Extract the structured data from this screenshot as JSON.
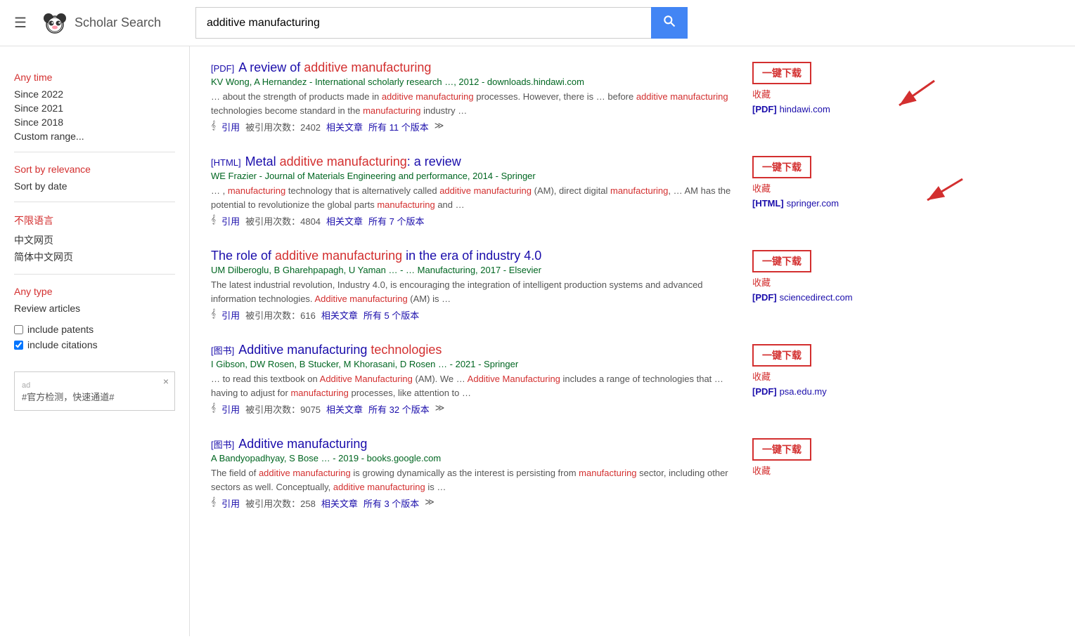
{
  "header": {
    "menu_icon": "☰",
    "logo_alt": "Scholar Search panda logo",
    "logo_text": "Scholar Search",
    "search_value": "additive manufacturing",
    "search_placeholder": "Search"
  },
  "sidebar": {
    "time_section_title": "Any time",
    "time_items": [
      {
        "label": "Since 2022",
        "active": false
      },
      {
        "label": "Since 2021",
        "active": false
      },
      {
        "label": "Since 2018",
        "active": false
      },
      {
        "label": "Custom range...",
        "active": false
      }
    ],
    "sort_section_title": "Sort by relevance",
    "sort_items": [
      {
        "label": "Sort by date",
        "active": false
      }
    ],
    "lang_section_title": "不限语言",
    "lang_items": [
      {
        "label": "中文网页"
      },
      {
        "label": "简体中文网页"
      }
    ],
    "type_section_title": "Any type",
    "type_items": [
      {
        "label": "Review articles"
      }
    ],
    "include_patents_label": "include patents",
    "include_citations_label": "include citations",
    "ad_text": "#官方检测，快速通道#",
    "ad_label": "ad",
    "ad_close": "×"
  },
  "results": [
    {
      "type_tag": "[PDF]",
      "title_parts": [
        "A review of ",
        "additive manufacturing"
      ],
      "title_plain": "A review of additive manufacturing",
      "authors_text": "KV Wong, A Hernandez",
      "journal_text": "International scholarly research …, 2012 - downloads.hindawi.com",
      "snippet": "… about the strength of products made in additive manufacturing processes. However, there is … before additive manufacturing technologies become standard in the manufacturing industry …",
      "meta_cite": "引用",
      "meta_cited": "被引用次数：2402",
      "meta_related": "相关文章",
      "meta_versions": "所有 11 个版本",
      "meta_more": "≫",
      "actions": {
        "download": "一键下载",
        "collect": "收藏",
        "pdf_tag": "[PDF]",
        "pdf_site": "hindawi.com"
      }
    },
    {
      "type_tag": "[HTML]",
      "title_parts": [
        "Metal ",
        "additive manufacturing",
        ": a review"
      ],
      "title_plain": "Metal additive manufacturing: a review",
      "authors_text": "WE Frazier",
      "journal_text": "Journal of Materials Engineering and performance, 2014 - Springer",
      "snippet": "… , manufacturing technology that is alternatively called additive manufacturing (AM), direct digital manufacturing, … AM has the potential to revolutionize the global parts manufacturing and …",
      "meta_cite": "引用",
      "meta_cited": "被引用次数：4804",
      "meta_related": "相关文章",
      "meta_versions": "所有 7 个版本",
      "meta_more": "",
      "actions": {
        "download": "一键下载",
        "collect": "收藏",
        "pdf_tag": "[HTML]",
        "pdf_site": "springer.com"
      }
    },
    {
      "type_tag": "",
      "title_parts": [
        "The role of ",
        "additive manufacturing",
        " in the era of industry 4.0"
      ],
      "title_plain": "The role of additive manufacturing in the era of industry 4.0",
      "authors_text": "UM Dilberoglu, B Gharehpapagh, U Yaman",
      "journal_text": "… - … Manufacturing, 2017 - Elsevier",
      "snippet": "The latest industrial revolution, Industry 4.0, is encouraging the integration of intelligent production systems and advanced information technologies. Additive manufacturing (AM) is …",
      "meta_cite": "引用",
      "meta_cited": "被引用次数：616",
      "meta_related": "相关文章",
      "meta_versions": "所有 5 个版本",
      "meta_more": "",
      "actions": {
        "download": "一键下载",
        "collect": "收藏",
        "pdf_tag": "[PDF]",
        "pdf_site": "sciencedirect.com"
      }
    },
    {
      "type_tag": "[图书]",
      "title_parts": [
        "Additive manufacturing ",
        "technologies"
      ],
      "title_plain": "Additive manufacturing technologies",
      "authors_text": "I Gibson, DW Rosen, B Stucker, M Khorasani, D Rosen",
      "journal_text": "… - 2021 - Springer",
      "snippet": "… to read this textbook on Additive Manufacturing (AM). We … Additive Manufacturing includes a range of technologies that … having to adjust for manufacturing processes, like attention to …",
      "meta_cite": "引用",
      "meta_cited": "被引用次数：9075",
      "meta_related": "相关文章",
      "meta_versions": "所有 32 个版本",
      "meta_more": "≫",
      "actions": {
        "download": "一键下载",
        "collect": "收藏",
        "pdf_tag": "[PDF]",
        "pdf_site": "psa.edu.my"
      }
    },
    {
      "type_tag": "[图书]",
      "title_parts": [
        "Additive manufacturing"
      ],
      "title_plain": "Additive manufacturing",
      "authors_text": "A Bandyopadhyay, S Bose",
      "journal_text": "… - 2019 - books.google.com",
      "snippet": "The field of additive manufacturing is growing dynamically as the interest is persisting from manufacturing sector, including other sectors as well. Conceptually, additive manufacturing is …",
      "meta_cite": "引用",
      "meta_cited": "被引用次数：258",
      "meta_related": "相关文章",
      "meta_versions": "所有 3 个版本",
      "meta_more": "≫",
      "actions": {
        "download": "一键下载",
        "collect": "收藏",
        "pdf_tag": "",
        "pdf_site": ""
      }
    }
  ]
}
